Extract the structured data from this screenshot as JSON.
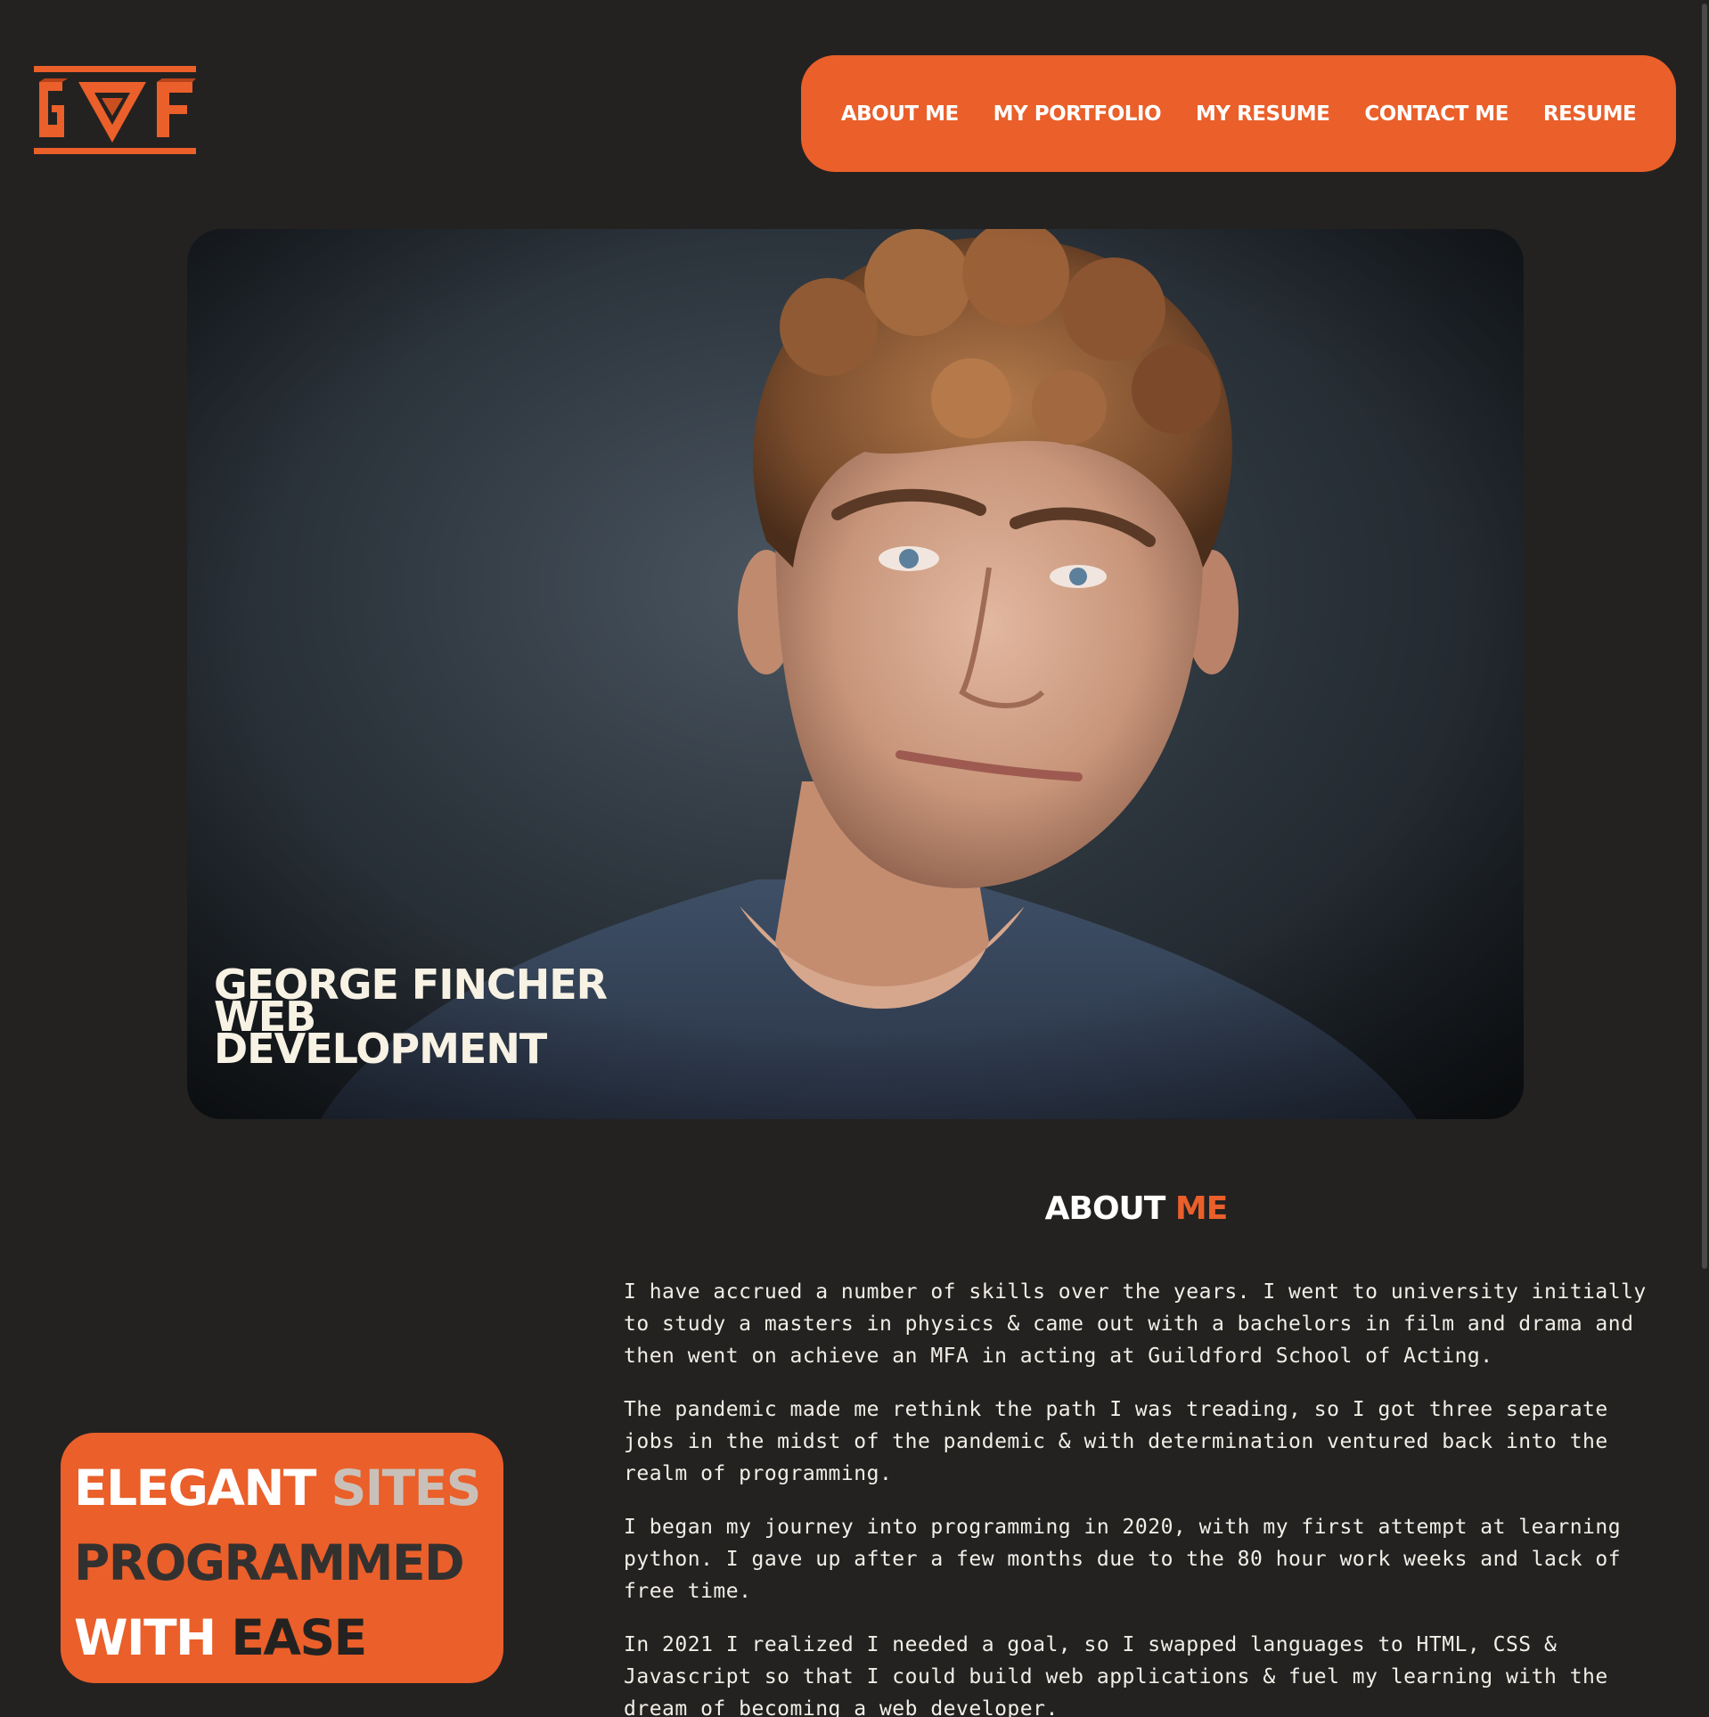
{
  "logo": {
    "letters": "GWF",
    "accent": "#ea5f2a"
  },
  "nav": {
    "items": [
      {
        "label": "ABOUT ME"
      },
      {
        "label": "MY PORTFOLIO"
      },
      {
        "label": "MY RESUME"
      },
      {
        "label": "CONTACT ME"
      },
      {
        "label": "RESUME"
      }
    ]
  },
  "hero": {
    "title_line1": "GEORGE FINCHER",
    "title_line2": "WEB",
    "title_line3": "DEVELOPMENT"
  },
  "about": {
    "heading_word1": "ABOUT",
    "heading_word2": "ME",
    "paragraphs": [
      "I have accrued a number of skills over the years. I went to university initially to study a masters in physics & came out with a bachelors in film and drama and then went on achieve an MFA in acting at Guildford School of Acting.",
      "The pandemic made me rethink the path I was treading, so I got three separate jobs in the midst of the pandemic & with determination ventured back into the realm of programming.",
      "I began my journey into programming in 2020, with my first attempt at learning python. I gave up after a few months due to the 80 hour work weeks and lack of free time.",
      "In 2021 I realized I needed a goal, so I swapped languages to HTML, CSS & Javascript so that I could build web applications & fuel my learning with the dream of becoming a web developer."
    ]
  },
  "tagline": {
    "w1": "ELEGANT",
    "w2": "SITES",
    "w3": "PROGRAMMED",
    "w4": "WITH",
    "w5": "EASE"
  },
  "colors": {
    "background": "#232221",
    "accent": "#ea5f2a",
    "text": "#f4f1e8"
  }
}
